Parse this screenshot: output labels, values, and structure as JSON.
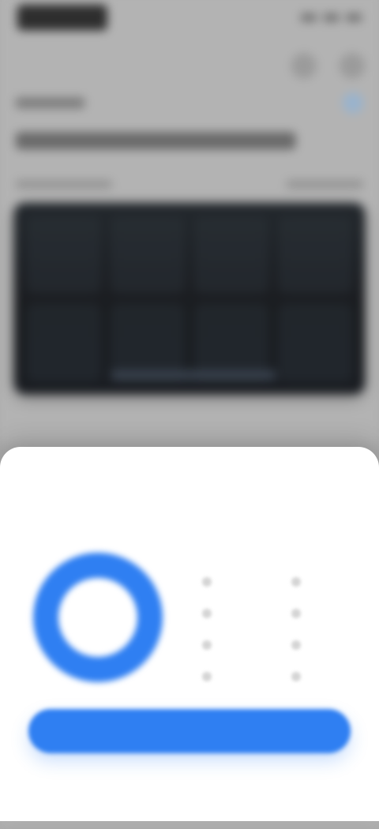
{
  "sheet": {
    "title": "",
    "subtitle": "",
    "primary_button_label": "",
    "donut_center_label": "",
    "legend": [
      {
        "label": "",
        "color": "#b2b2b2"
      },
      {
        "label": "",
        "color": "#b2b2b2"
      },
      {
        "label": "",
        "color": "#b2b2b2"
      },
      {
        "label": "",
        "color": "#b2b2b2"
      },
      {
        "label": "",
        "color": "#b2b2b2"
      },
      {
        "label": "",
        "color": "#b2b2b2"
      },
      {
        "label": "",
        "color": "#b2b2b2"
      },
      {
        "label": "",
        "color": "#b2b2b2"
      }
    ],
    "accent_color": "#2f7ff2"
  }
}
